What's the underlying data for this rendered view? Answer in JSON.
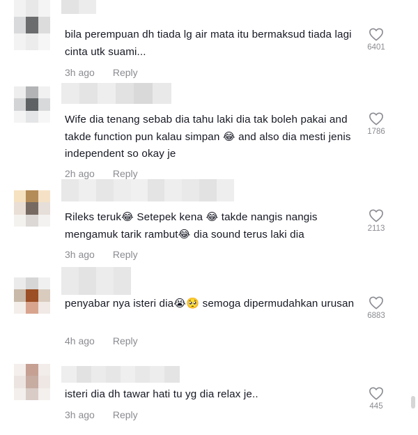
{
  "comments": [
    {
      "text": "bila perempuan dh tiada lg air mata itu bermaksud tiada lagi cinta utk suami...",
      "time": "3h ago",
      "reply": "Reply",
      "likes": "6401",
      "icon": "heart-outline-icon"
    },
    {
      "text": "Wife dia tenang sebab dia tahu laki dia tak boleh pakai and takde function pun kalau simpan 😂 and also dia mesti jenis independent so okay je",
      "time": "2h ago",
      "reply": "Reply",
      "likes": "1786",
      "icon": "heart-outline-icon"
    },
    {
      "text": "Rileks teruk😂 Setepek kena 😂 takde nangis nangis mengamuk tarik rambut😂 dia sound terus laki dia",
      "time": "3h ago",
      "reply": "Reply",
      "likes": "2113",
      "icon": "heart-outline-icon"
    },
    {
      "text": "penyabar nya isteri dia😭🥺 semoga dipermudahkan urusan",
      "time": "4h ago",
      "reply": "Reply",
      "likes": "6883",
      "icon": "heart-outline-icon"
    },
    {
      "text": "isteri dia dh tawar hati tu yg dia relax je..",
      "time": "3h ago",
      "reply": "Reply",
      "likes": "445",
      "icon": "heart-outline-icon"
    }
  ],
  "colors": {
    "text": "#161823",
    "meta": "#8a8b91"
  }
}
